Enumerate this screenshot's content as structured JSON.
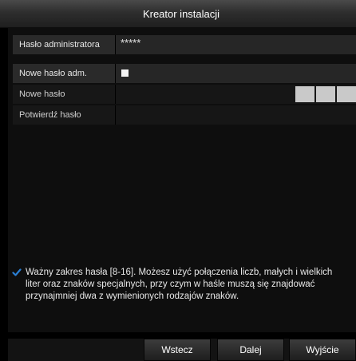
{
  "window": {
    "title": "Kreator instalacji"
  },
  "form": {
    "admin_password": {
      "label": "Hasło administratora",
      "value": "*****"
    },
    "new_admin_password": {
      "label": "Nowe hasło adm.",
      "checked": true
    },
    "new_password": {
      "label": "Nowe hasło",
      "strength_segments": 3
    },
    "confirm_password": {
      "label": "Potwierdź hasło"
    }
  },
  "note": {
    "icon": "checkmark-icon",
    "text": "Ważny zakres hasła [8-16]. Możesz użyć połączenia liczb, małych i wielkich liter oraz znaków specjalnych, przy czym w haśle muszą się znajdować przynajmniej dwa z wymienionych rodzajów znaków."
  },
  "footer": {
    "back_label": "Wstecz",
    "next_label": "Dalej",
    "exit_label": "Wyjście"
  },
  "colors": {
    "accent_check": "#2a7fd4",
    "background": "#000000"
  }
}
